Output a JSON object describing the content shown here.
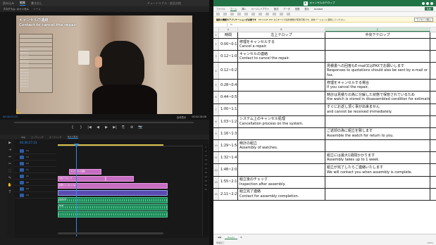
{
  "editor": {
    "menubar": {
      "left_items": [
        "読み込み",
        "編集",
        "書き出し"
      ],
      "active_index": 1,
      "title": "チュートリアル - 部品交換"
    },
    "source_panel_tabs": [
      "プログラム: キャンセル",
      "ソース"
    ],
    "video_caption": {
      "line1": "キャンセルの連絡",
      "line2": "Contact to cancel the repair."
    },
    "overlay_list": [
      "00:00:00",
      "00:00:01",
      "00:00:02",
      "00:00:03",
      "00:00:04",
      "00:00:05",
      "00:00:06",
      "00:00:07",
      "00:00:08",
      "00:00:09",
      "00:00:10",
      "00:00:11",
      "00:00:12",
      "00:00:13"
    ],
    "monitor_timecode": "00:00:27:23",
    "monitor_fit": "全体表示",
    "monitor_duration": "00:02:28:08",
    "transport_buttons": [
      "{",
      "}",
      "|◀",
      "◀",
      "▶",
      "▶|",
      "⎘",
      "⊕",
      "📷"
    ],
    "timeline_tabs": [
      "本編",
      "エンディング",
      "オープニング",
      "キャンセル"
    ],
    "timeline_timecode": "00:00:27:23",
    "tracks": [
      "V4",
      "V3",
      "V2",
      "V1",
      "A1",
      "A2",
      "A3",
      "A4"
    ],
    "tools": [
      "▶",
      "⇥",
      "⇔",
      "✂",
      "⬚",
      "✎",
      "✋",
      "T"
    ],
    "meter_labels": [
      "0",
      "-6",
      "-12",
      "-18",
      "-24",
      "-30",
      "-36",
      "-42",
      "-48",
      "-54",
      "dB"
    ],
    "clips": {
      "v3_title": "キャンセルの連絡",
      "v2_subtitle": "中央下テロップ",
      "v1_video": "修理キャンセル.mp4",
      "a1_audio": "会話音声",
      "a2_audio": "BGM"
    }
  },
  "excel": {
    "title": "キャンセルのテロップ",
    "menu": [
      "ファイル",
      "ホーム",
      "挿入",
      "ページレイアウト",
      "数式",
      "データ",
      "校閲",
      "表示",
      "Acrobat"
    ],
    "menu_active_index": 1,
    "share_label": "共有",
    "notice": {
      "bold": "最新の機能やアプリケーションが必要です",
      "text": "Microsoft 365 ならすべての最新機能が使用可能です。最新バージョンに更新してください。",
      "button": "ライセンス購入"
    },
    "columns": [
      "A",
      "B",
      "C"
    ],
    "selected_column_index": 2,
    "header": {
      "a": "時間",
      "b": "左上テロップ",
      "c": "中央下テロップ"
    },
    "rows": [
      {
        "num": "2",
        "a": "0:00~0:12",
        "b": [
          "修理をキャンセルする",
          "Cancel a repair."
        ],
        "c": []
      },
      {
        "num": "3",
        "a": "0:12~1:02",
        "b": [
          "キャンセルの連絡",
          "Contact to cancel the repair."
        ],
        "c": []
      },
      {
        "num": "4",
        "a": "0:12~0:27",
        "b": [],
        "c": [
          "見積書への回答もE-mail又はFAXでお願いします",
          "Responses to quotations should also be sent by e-mail or",
          "fax."
        ]
      },
      {
        "num": "5",
        "a": "0:28~0:43",
        "b": [],
        "c": [
          "修理をキャンセルする場合",
          "If you cancel the repair,"
        ]
      },
      {
        "num": "6",
        "a": "0:44~0:59",
        "b": [],
        "c": [
          "時計は見積りの為に分解した状態で保管されているため",
          "the watch is stored in disassembled condition for estimation"
        ]
      },
      {
        "num": "7",
        "a": "1:00~1:15",
        "b": [],
        "c": [
          "すぐにお返し頂く事が出来ません",
          "and cannot be received immediately."
        ]
      },
      {
        "num": "8",
        "a": "1:03~1:28",
        "b": [
          "システム上のキャンセル処理",
          "Cancellation process on the system."
        ],
        "c": []
      },
      {
        "num": "9",
        "a": "1:16~1:31",
        "b": [],
        "c": [
          "ご返却の為に組立を致します",
          "Assemble the watch for return to you."
        ]
      },
      {
        "num": "10",
        "a": "1:29~1:54",
        "b": [
          "時計の組立",
          "Assembly of watches."
        ],
        "c": []
      },
      {
        "num": "11",
        "a": "1:32~1:47",
        "b": [],
        "c": [
          "組立には最大1週間かかります",
          "Assembly takes up to 1 week."
        ]
      },
      {
        "num": "12",
        "a": "1:48~2:03",
        "b": [],
        "c": [
          "組立が完了したらご連絡いたします",
          "We will contact you when assembly is complete."
        ]
      },
      {
        "num": "13",
        "a": "1:55~2:10",
        "b": [
          "組立後のチェック",
          "Inspection after assembly."
        ],
        "c": []
      },
      {
        "num": "14",
        "a": "2:11~2:23",
        "b": [
          "組立完了連絡",
          "Contact for assembly completion."
        ],
        "c": []
      }
    ],
    "sheet_tab": "Sheet1",
    "status_left": "準備完了",
    "zoom": "100%"
  },
  "colors": {
    "excel_green": "#217346",
    "premiere_blue": "#2d8ceb",
    "clip_pink": "#c76ec2",
    "clip_audio": "#1e8a5a"
  }
}
